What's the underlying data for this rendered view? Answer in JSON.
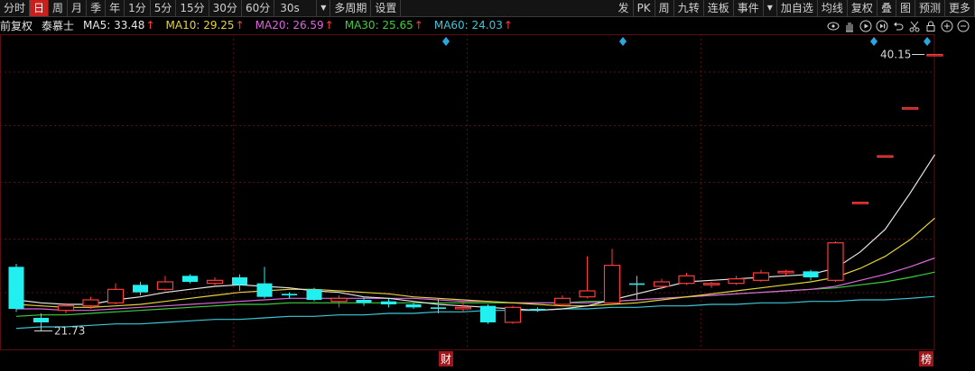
{
  "toolbar": {
    "left_tabs": [
      "分时",
      "日",
      "周",
      "月",
      "季",
      "年",
      "1分",
      "5分",
      "15分",
      "30分",
      "60分"
    ],
    "active_tab": "日",
    "interval_select": "30s",
    "left_tail": [
      "多周期",
      "设置"
    ],
    "right_items": [
      "发",
      "PK",
      "周",
      "九转",
      "连板",
      "事件",
      "加自选",
      "均线",
      "复权",
      "叠",
      "图",
      "预测",
      "更多"
    ]
  },
  "mabar": {
    "mode": "前复权",
    "stock_name": "泰慕士",
    "ma": [
      {
        "label": "MA5: 33.48",
        "color": "#e8e8e8"
      },
      {
        "label": "MA10: 29.25",
        "color": "#e7d33a"
      },
      {
        "label": "MA20: 26.59",
        "color": "#e065e0"
      },
      {
        "label": "MA30: 25.65",
        "color": "#3ccf3c"
      },
      {
        "label": "MA60: 24.03",
        "color": "#3bc8d8"
      }
    ],
    "up_arrow": "↑"
  },
  "tools": [
    "eye-icon",
    "hand-icon",
    "play-icon",
    "step-icon",
    "undo-icon",
    "scissors-icon",
    "lock-icon",
    "zoom-in-icon",
    "zoom-out-icon"
  ],
  "colors": {
    "up": "#ff3b3b",
    "down": "#22f0f0",
    "grid": "#5a0f12",
    "ma5": "#e8e8e8",
    "ma10": "#e7d33a",
    "ma20": "#e065e0",
    "ma30": "#3ccf3c",
    "ma60": "#3bc8d8"
  },
  "chart_data": {
    "type": "candlestick",
    "ylim": [
      20.5,
      41.5
    ],
    "annotations": {
      "high_label": "40.15",
      "low_label": "21.73",
      "event_markers": [
        "财",
        "榜"
      ]
    },
    "candles": [
      {
        "o": 26.0,
        "c": 23.2,
        "h": 26.2,
        "l": 23.0
      },
      {
        "o": 22.6,
        "c": 22.3,
        "h": 22.9,
        "l": 21.73
      },
      {
        "o": 23.1,
        "c": 23.4,
        "h": 23.6,
        "l": 22.9
      },
      {
        "o": 23.4,
        "c": 23.8,
        "h": 24.0,
        "l": 23.2
      },
      {
        "o": 23.6,
        "c": 24.5,
        "h": 24.9,
        "l": 23.5
      },
      {
        "o": 24.8,
        "c": 24.3,
        "h": 25.0,
        "l": 24.1
      },
      {
        "o": 24.5,
        "c": 25.0,
        "h": 25.4,
        "l": 24.4
      },
      {
        "o": 25.4,
        "c": 25.0,
        "h": 25.5,
        "l": 24.9
      },
      {
        "o": 24.9,
        "c": 25.1,
        "h": 25.3,
        "l": 24.7
      },
      {
        "o": 25.3,
        "c": 24.8,
        "h": 25.5,
        "l": 24.4
      },
      {
        "o": 24.9,
        "c": 24.0,
        "h": 26.0,
        "l": 23.9
      },
      {
        "o": 24.2,
        "c": 24.1,
        "h": 24.3,
        "l": 23.9
      },
      {
        "o": 24.5,
        "c": 23.8,
        "h": 24.6,
        "l": 23.7
      },
      {
        "o": 23.7,
        "c": 23.9,
        "h": 24.1,
        "l": 23.3
      },
      {
        "o": 23.8,
        "c": 23.6,
        "h": 24.0,
        "l": 23.4
      },
      {
        "o": 23.7,
        "c": 23.5,
        "h": 23.9,
        "l": 23.3
      },
      {
        "o": 23.5,
        "c": 23.3,
        "h": 23.6,
        "l": 23.2
      },
      {
        "o": 23.3,
        "c": 23.2,
        "h": 23.9,
        "l": 22.9
      },
      {
        "o": 23.2,
        "c": 23.3,
        "h": 23.7,
        "l": 23.0
      },
      {
        "o": 23.4,
        "c": 22.3,
        "h": 23.5,
        "l": 22.2
      },
      {
        "o": 22.3,
        "c": 23.3,
        "h": 23.4,
        "l": 22.2
      },
      {
        "o": 23.2,
        "c": 23.1,
        "h": 23.3,
        "l": 23.0
      },
      {
        "o": 23.5,
        "c": 23.9,
        "h": 24.1,
        "l": 23.4
      },
      {
        "o": 24.0,
        "c": 24.4,
        "h": 26.7,
        "l": 23.9
      },
      {
        "o": 23.6,
        "c": 26.1,
        "h": 27.2,
        "l": 23.5
      },
      {
        "o": 24.9,
        "c": 24.8,
        "h": 25.4,
        "l": 23.8
      },
      {
        "o": 24.7,
        "c": 25.0,
        "h": 25.2,
        "l": 24.5
      },
      {
        "o": 24.9,
        "c": 25.4,
        "h": 25.6,
        "l": 24.8
      },
      {
        "o": 24.8,
        "c": 24.9,
        "h": 25.0,
        "l": 24.6
      },
      {
        "o": 24.9,
        "c": 25.2,
        "h": 25.4,
        "l": 24.8
      },
      {
        "o": 25.1,
        "c": 25.6,
        "h": 25.8,
        "l": 25.0
      },
      {
        "o": 25.6,
        "c": 25.7,
        "h": 25.8,
        "l": 25.4
      },
      {
        "o": 25.7,
        "c": 25.3,
        "h": 25.8,
        "l": 25.1
      },
      {
        "o": 25.1,
        "c": 27.6,
        "h": 27.7,
        "l": 25.0
      },
      {
        "o": 30.3,
        "c": 30.3,
        "h": 30.3,
        "l": 30.3
      },
      {
        "o": 33.4,
        "c": 33.4,
        "h": 33.4,
        "l": 33.4
      },
      {
        "o": 36.6,
        "c": 36.6,
        "h": 36.6,
        "l": 36.6
      },
      {
        "o": 40.15,
        "c": 40.15,
        "h": 40.15,
        "l": 40.15
      }
    ],
    "ma_lines": {
      "ma5": [
        23.8,
        23.6,
        23.5,
        23.5,
        23.8,
        24.0,
        24.3,
        24.5,
        24.7,
        24.8,
        24.7,
        24.6,
        24.4,
        24.3,
        24.0,
        23.9,
        23.7,
        23.5,
        23.4,
        23.3,
        23.2,
        23.1,
        23.2,
        23.4,
        23.8,
        24.2,
        24.6,
        25.0,
        25.1,
        25.2,
        25.3,
        25.4,
        25.5,
        25.9,
        27.0,
        28.5,
        30.9,
        33.48
      ],
      "ma10": [
        23.5,
        23.4,
        23.3,
        23.3,
        23.4,
        23.5,
        23.7,
        23.9,
        24.1,
        24.3,
        24.4,
        24.5,
        24.5,
        24.4,
        24.3,
        24.2,
        24.0,
        23.9,
        23.8,
        23.7,
        23.6,
        23.5,
        23.4,
        23.4,
        23.5,
        23.6,
        23.8,
        24.0,
        24.2,
        24.4,
        24.6,
        24.8,
        25.0,
        25.3,
        25.9,
        26.7,
        27.8,
        29.25
      ],
      "ma20": [
        23.2,
        23.2,
        23.1,
        23.1,
        23.2,
        23.3,
        23.4,
        23.5,
        23.6,
        23.7,
        23.8,
        23.9,
        23.9,
        23.9,
        23.9,
        23.9,
        23.9,
        23.8,
        23.7,
        23.7,
        23.6,
        23.6,
        23.6,
        23.6,
        23.7,
        23.8,
        23.9,
        24.0,
        24.1,
        24.2,
        24.3,
        24.4,
        24.5,
        24.7,
        25.1,
        25.5,
        26.0,
        26.59
      ],
      "ma30": [
        22.7,
        22.8,
        22.8,
        22.9,
        23.0,
        23.1,
        23.2,
        23.3,
        23.4,
        23.5,
        23.5,
        23.6,
        23.6,
        23.6,
        23.6,
        23.6,
        23.6,
        23.6,
        23.6,
        23.6,
        23.6,
        23.6,
        23.6,
        23.7,
        23.7,
        23.8,
        23.9,
        24.0,
        24.1,
        24.2,
        24.3,
        24.4,
        24.5,
        24.6,
        24.8,
        25.0,
        25.3,
        25.65
      ],
      "ma60": [
        21.9,
        22.0,
        22.0,
        22.1,
        22.2,
        22.2,
        22.3,
        22.4,
        22.5,
        22.5,
        22.6,
        22.7,
        22.7,
        22.8,
        22.8,
        22.9,
        22.9,
        23.0,
        23.0,
        23.1,
        23.1,
        23.1,
        23.2,
        23.2,
        23.3,
        23.3,
        23.4,
        23.4,
        23.5,
        23.5,
        23.6,
        23.6,
        23.7,
        23.7,
        23.8,
        23.8,
        23.9,
        24.03
      ]
    }
  }
}
